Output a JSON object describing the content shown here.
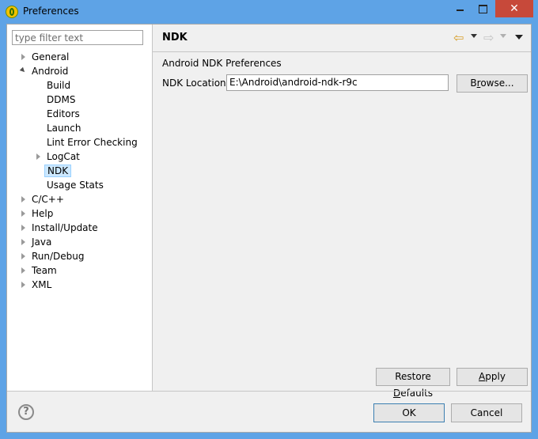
{
  "window": {
    "title": "Preferences"
  },
  "sidebar": {
    "filter_placeholder": "type filter text",
    "items": [
      {
        "label": "General",
        "state": "collapsed",
        "level": 0
      },
      {
        "label": "Android",
        "state": "expanded",
        "level": 0
      },
      {
        "label": "Build",
        "level": 1
      },
      {
        "label": "DDMS",
        "level": 1
      },
      {
        "label": "Editors",
        "level": 1
      },
      {
        "label": "Launch",
        "level": 1
      },
      {
        "label": "Lint Error Checking",
        "level": 1
      },
      {
        "label": "LogCat",
        "state": "collapsed",
        "level": 1
      },
      {
        "label": "NDK",
        "level": 1,
        "selected": true
      },
      {
        "label": "Usage Stats",
        "level": 1
      },
      {
        "label": "C/C++",
        "state": "collapsed",
        "level": 0
      },
      {
        "label": "Help",
        "state": "collapsed",
        "level": 0
      },
      {
        "label": "Install/Update",
        "state": "collapsed",
        "level": 0
      },
      {
        "label": "Java",
        "state": "collapsed",
        "level": 0
      },
      {
        "label": "Run/Debug",
        "state": "collapsed",
        "level": 0
      },
      {
        "label": "Team",
        "state": "collapsed",
        "level": 0
      },
      {
        "label": "XML",
        "state": "collapsed",
        "level": 0
      }
    ]
  },
  "page": {
    "title": "NDK",
    "section_label": "Android NDK Preferences",
    "ndk_location_label": "NDK Location",
    "ndk_location_value": "E:\\Android\\android-ndk-r9c",
    "browse_pre": "B",
    "browse_ul": "r",
    "browse_post": "owse...",
    "restore_pre": "Restore ",
    "restore_ul": "D",
    "restore_post": "efaults",
    "apply_ul": "A",
    "apply_post": "pply"
  },
  "footer": {
    "help_glyph": "?",
    "ok_label": "OK",
    "cancel_label": "Cancel"
  },
  "icons": {
    "back": "back-arrow-icon",
    "forward": "forward-arrow-icon",
    "view_menu": "view-menu-icon",
    "help": "help-icon"
  },
  "colors": {
    "titlebar": "#5ea3e6",
    "close_button": "#c7493a",
    "selection": "#cce8ff"
  }
}
